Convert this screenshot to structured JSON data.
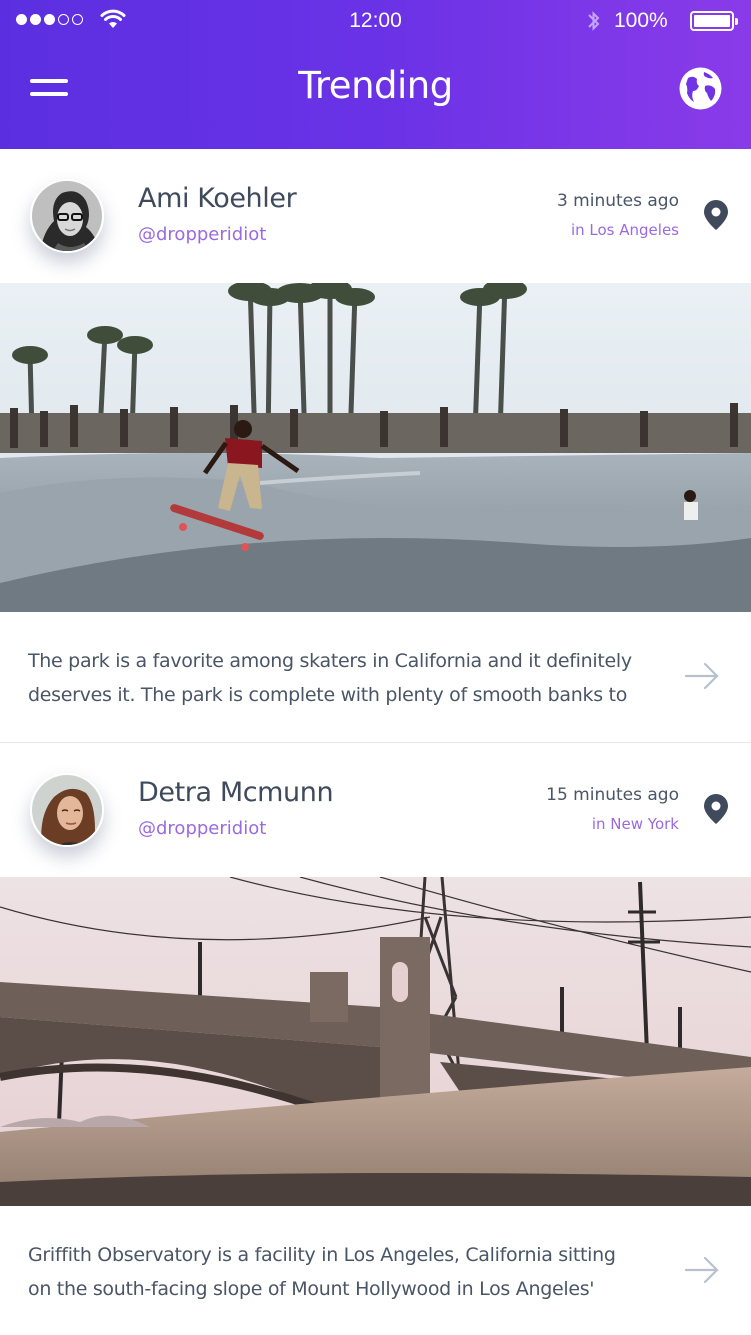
{
  "status_bar": {
    "time": "12:00",
    "battery": "100%",
    "signal_bars_filled": 3,
    "signal_bars_total": 5
  },
  "header": {
    "title": "Trending",
    "menu_icon": "hamburger-icon",
    "globe_icon": "globe-icon",
    "gradient": [
      "#5b2fe0",
      "#8a3be9"
    ]
  },
  "posts": [
    {
      "name": "Ami Koehler",
      "handle": "@dropperidiot",
      "time_ago": "3 minutes ago",
      "location": "in Los Angeles",
      "caption_lines": [
        "The park is a favorite among skaters in California and it definitely",
        "deserves it. The park is complete with plenty of smooth banks to"
      ]
    },
    {
      "name": "Detra Mcmunn",
      "handle": "@dropperidiot",
      "time_ago": "15 minutes ago",
      "location": "in New York",
      "caption_lines": [
        "Griffith Observatory is a facility in Los Angeles, California sitting",
        "on the south-facing slope of Mount Hollywood in Los Angeles'"
      ]
    }
  ],
  "colors": {
    "accent": "#9b6ae0",
    "text": "#4a5566",
    "arrow": "#b7c0cc"
  }
}
